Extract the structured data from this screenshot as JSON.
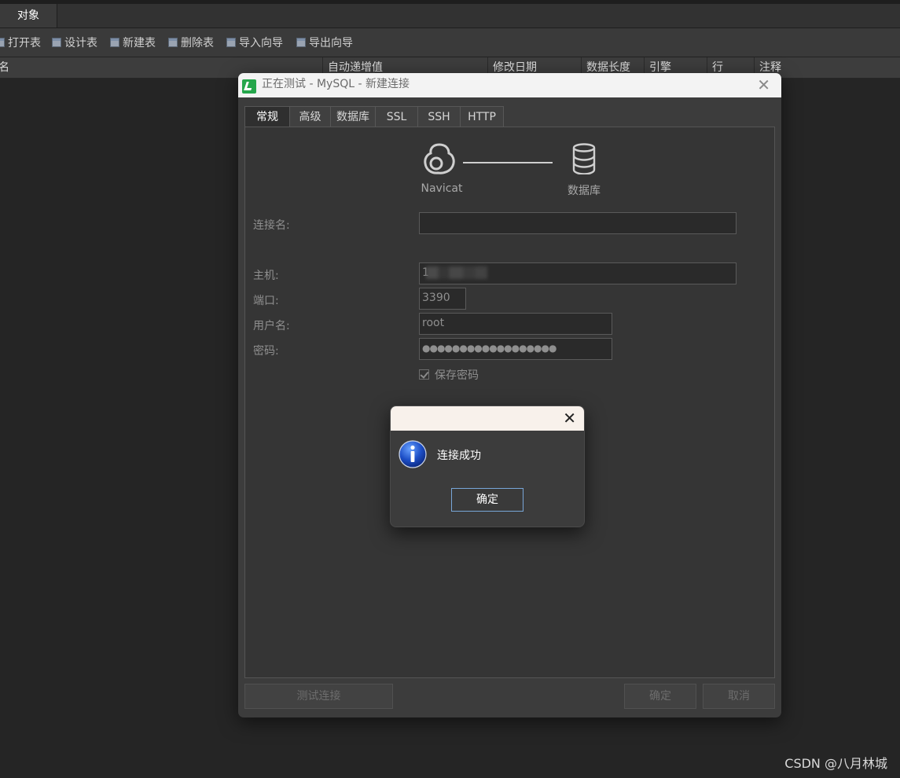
{
  "app": {
    "tab_objects": "对象",
    "toolbar": [
      "打开表",
      "设计表",
      "新建表",
      "删除表",
      "导入向导",
      "导出向导"
    ],
    "columns": [
      "名",
      "自动递增值",
      "修改日期",
      "数据长度",
      "引擎",
      "行",
      "注释"
    ],
    "watermark": "CSDN @八月林城"
  },
  "dialog": {
    "title": "正在测试 - MySQL - 新建连接",
    "tabs": [
      "常规",
      "高级",
      "数据库",
      "SSL",
      "SSH",
      "HTTP"
    ],
    "active_tab": "常规",
    "graphic": {
      "left_label": "Navicat",
      "right_label": "数据库"
    },
    "fields": {
      "conn_name_label": "连接名:",
      "conn_name_value": "",
      "host_label": "主机:",
      "host_value": "1",
      "port_label": "端口:",
      "port_value": "3390",
      "user_label": "用户名:",
      "user_value": "root",
      "password_label": "密码:",
      "password_value": "●●●●●●●●●●●●●●●●●●",
      "save_password_label": "保存密码",
      "save_password_checked": true
    },
    "buttons": {
      "test": "测试连接",
      "ok": "确定",
      "cancel": "取消"
    }
  },
  "message": {
    "text": "连接成功",
    "ok": "确定"
  },
  "colors": {
    "accent_green": "#25a64b",
    "focus_blue": "#78a6d8"
  }
}
